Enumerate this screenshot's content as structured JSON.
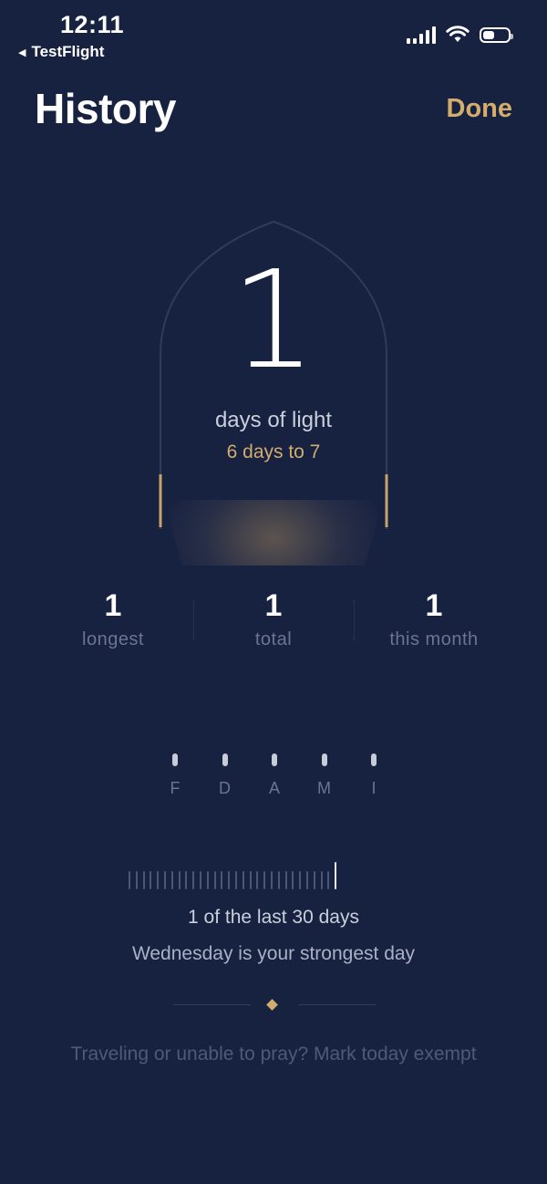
{
  "status_bar": {
    "time": "12:11",
    "back_label": "TestFlight",
    "icons": [
      "signal-icon",
      "wifi-icon",
      "battery-icon"
    ]
  },
  "header": {
    "title": "History",
    "done_label": "Done"
  },
  "streak": {
    "value": "1",
    "label": "days of light",
    "goal_text": "6 days to 7"
  },
  "stats": [
    {
      "value": "1",
      "label": "longest"
    },
    {
      "value": "1",
      "label": "total"
    },
    {
      "value": "1",
      "label": "this month"
    }
  ],
  "prayers": [
    "F",
    "D",
    "A",
    "M",
    "I"
  ],
  "recent_days": {
    "total_days": 30,
    "active_days": 1,
    "summary": "1 of the last 30 days",
    "strongest": "Wednesday is your strongest day"
  },
  "exempt_text": "Traveling or unable to pray? Mark today exempt",
  "colors": {
    "background": "#172140",
    "accent_gold": "#d2ad6d",
    "muted_text": "#6b7592"
  }
}
